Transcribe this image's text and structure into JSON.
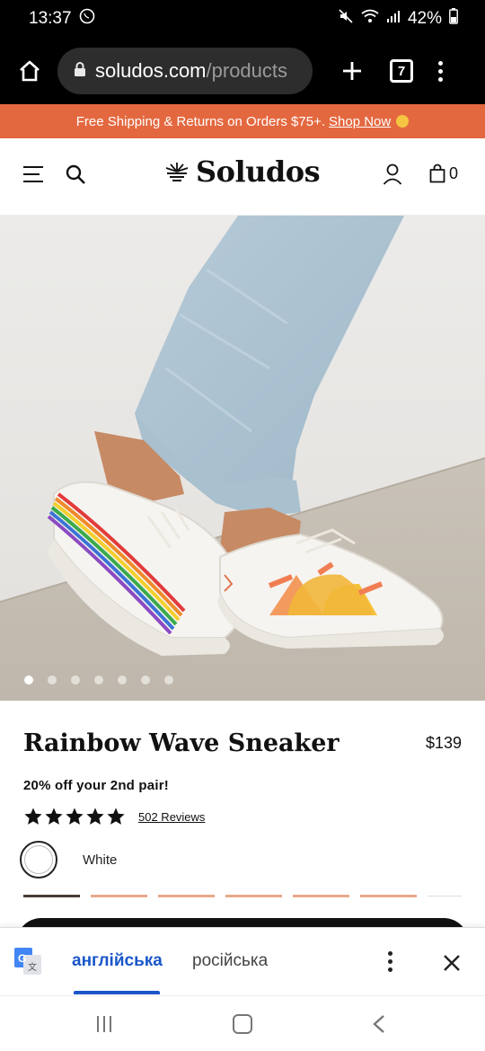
{
  "status": {
    "time": "13:37",
    "battery": "42%"
  },
  "browser": {
    "url_host": "soludos.com",
    "url_path": "/products",
    "tab_count": "7"
  },
  "promo": {
    "text": "Free Shipping & Returns on Orders $75+.",
    "link": "Shop Now"
  },
  "header": {
    "logo": "Soludos",
    "cart_count": "0"
  },
  "gallery": {
    "dot_count": 7,
    "active_index": 0
  },
  "product": {
    "title": "Rainbow Wave Sneaker",
    "price": "$139",
    "promo_line": "20% off your 2nd pair!",
    "rating": 5,
    "reviews": "502 Reviews",
    "color": "White"
  },
  "translate": {
    "source_lang": "англійська",
    "target_lang": "російська"
  },
  "colors": {
    "accent": "#e4683f",
    "translate_blue": "#1a56c9"
  }
}
